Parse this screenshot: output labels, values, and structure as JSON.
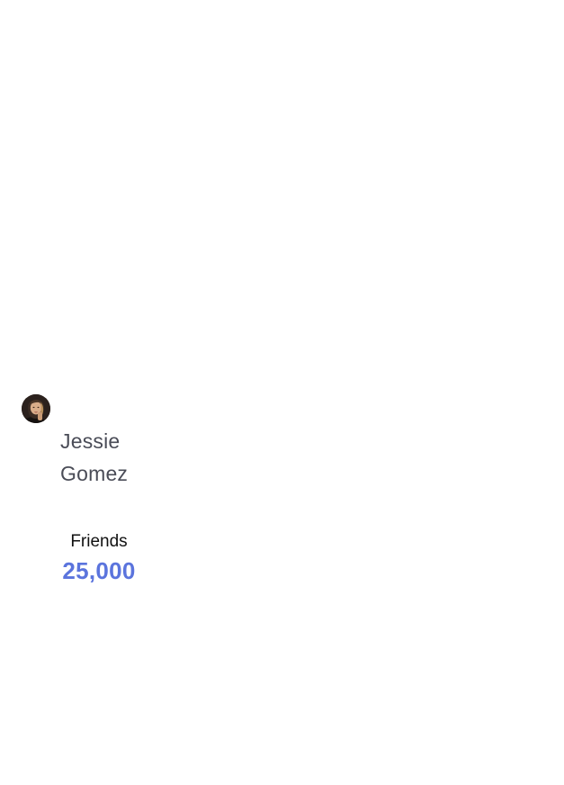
{
  "profile": {
    "avatar_icon": "user-photo",
    "first_name": "Jessie",
    "last_name": "Gomez",
    "stats": {
      "friends_label": "Friends",
      "friends_value": "25,000"
    }
  },
  "colors": {
    "background": "#ffffff",
    "name_text": "#4a4c57",
    "label_text": "#111111",
    "accent": "#5b74dd"
  }
}
